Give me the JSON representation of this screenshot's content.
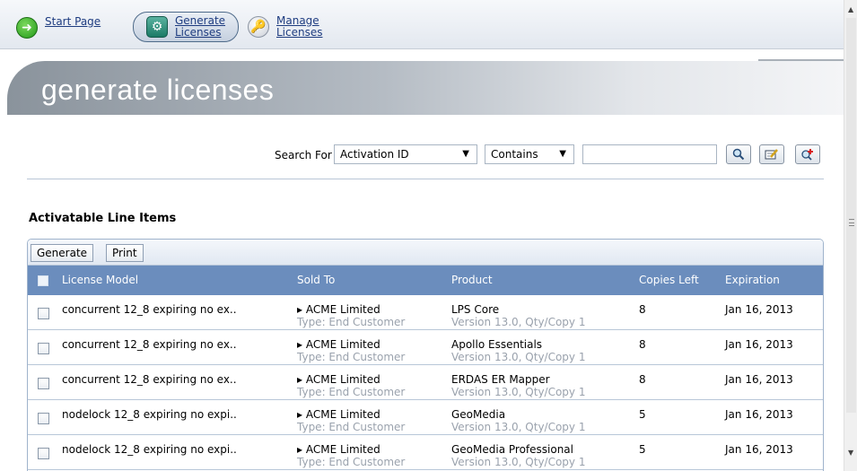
{
  "nav": {
    "tabs": [
      {
        "label_line1": "Start Page",
        "label_line2": "",
        "icon": "arrow-right-icon",
        "color": "#2ea823"
      },
      {
        "label_line1": "Generate",
        "label_line2": "Licenses",
        "icon": "gear-icon",
        "color": "#1b7a66",
        "active": true
      },
      {
        "label_line1": "Manage",
        "label_line2": "Licenses",
        "icon": "key-icon",
        "color": "#d08a17"
      }
    ]
  },
  "banner": {
    "title": "generate licenses"
  },
  "search": {
    "label": "Search For",
    "field_value": "Activation ID",
    "operator_value": "Contains",
    "query": "",
    "buttons": [
      "search-icon",
      "edit-icon",
      "add-icon"
    ]
  },
  "section": {
    "title": "Activatable Line Items"
  },
  "grid": {
    "toolbar": {
      "generate_label": "Generate",
      "print_label": "Print"
    },
    "columns": {
      "license_model": "License Model",
      "sold_to": "Sold To",
      "product": "Product",
      "copies_left": "Copies Left",
      "expiration": "Expiration"
    },
    "rows": [
      {
        "license_model": "concurrent 12_8 expiring no ex..",
        "sold_to": "ACME Limited",
        "sold_to_type": "Type: End Customer",
        "product": "LPS Core",
        "product_version": "Version 13.0, Qty/Copy 1",
        "copies_left": "8",
        "expiration": "Jan 16, 2013"
      },
      {
        "license_model": "concurrent 12_8 expiring no ex..",
        "sold_to": "ACME Limited",
        "sold_to_type": "Type: End Customer",
        "product": "Apollo Essentials",
        "product_version": "Version 13.0, Qty/Copy 1",
        "copies_left": "8",
        "expiration": "Jan 16, 2013"
      },
      {
        "license_model": "concurrent 12_8 expiring no ex..",
        "sold_to": "ACME Limited",
        "sold_to_type": "Type: End Customer",
        "product": "ERDAS ER Mapper",
        "product_version": "Version 13.0, Qty/Copy 1",
        "copies_left": "8",
        "expiration": "Jan 16, 2013"
      },
      {
        "license_model": "nodelock 12_8 expiring no expi..",
        "sold_to": "ACME Limited",
        "sold_to_type": "Type: End Customer",
        "product": "GeoMedia",
        "product_version": "Version 13.0, Qty/Copy 1",
        "copies_left": "5",
        "expiration": "Jan 16, 2013"
      },
      {
        "license_model": "nodelock 12_8 expiring no expi..",
        "sold_to": "ACME Limited",
        "sold_to_type": "Type: End Customer",
        "product": "GeoMedia Professional",
        "product_version": "Version 13.0, Qty/Copy 1",
        "copies_left": "5",
        "expiration": "Jan 16, 2013"
      }
    ]
  },
  "colors": {
    "header": "#6b8dbd",
    "link": "#1e3c80"
  }
}
